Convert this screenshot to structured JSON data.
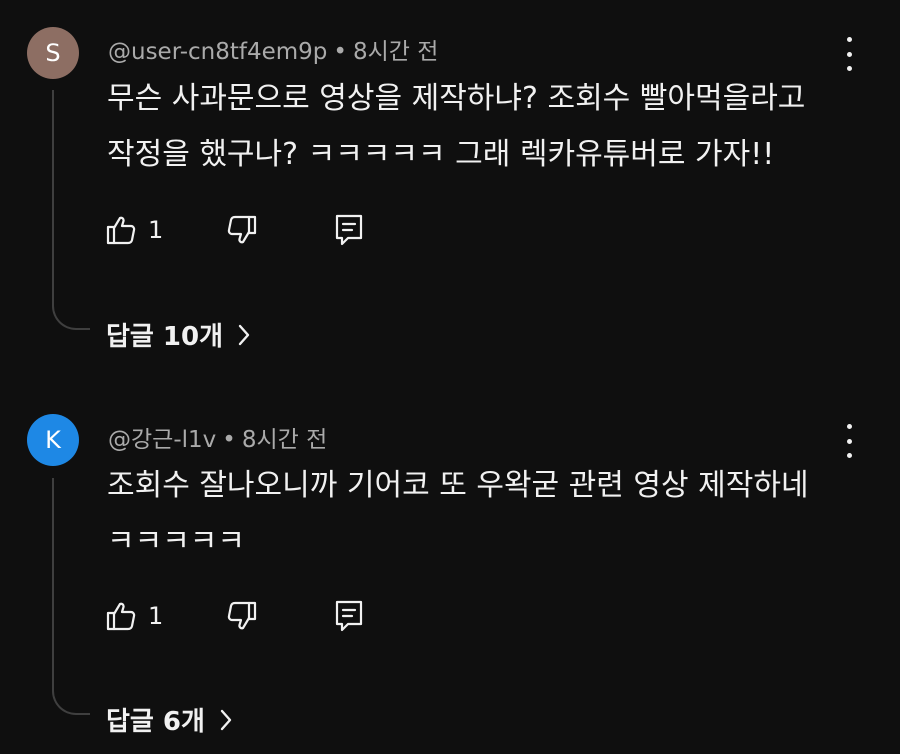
{
  "comments": [
    {
      "avatar_letter": "S",
      "avatar_color": "#8d6e63",
      "handle": "@user-cn8tf4em9p",
      "separator": "•",
      "time": "8시간 전",
      "text_lines": [
        "무슨 사과문으로 영상을 제작하냐? 조회수 빨아먹을라고",
        "작정을 했구나? ㅋㅋㅋㅋㅋ 그래 렉카유튜버로 가자!!"
      ],
      "like_count": "1",
      "replies_label": "답글 10개"
    },
    {
      "avatar_letter": "K",
      "avatar_color": "#1e88e5",
      "handle": "@강근-l1v",
      "separator": "•",
      "time": "8시간 전",
      "text_lines": [
        "조회수 잘나오니까 기어코 또 우왁굳 관련 영상 제작하네",
        "ㅋㅋㅋㅋㅋ"
      ],
      "like_count": "1",
      "replies_label": "답글 6개"
    }
  ],
  "icons": {
    "like": "thumb-up-icon",
    "dislike": "thumb-down-icon",
    "reply": "comment-reply-icon",
    "menu": "more-vertical-icon",
    "chevron": "chevron-right-icon"
  },
  "colors": {
    "background": "#0f0f0f",
    "text": "#f1f1f1",
    "secondary_text": "#aaaaaa",
    "thread_line": "#3f3f3f"
  }
}
